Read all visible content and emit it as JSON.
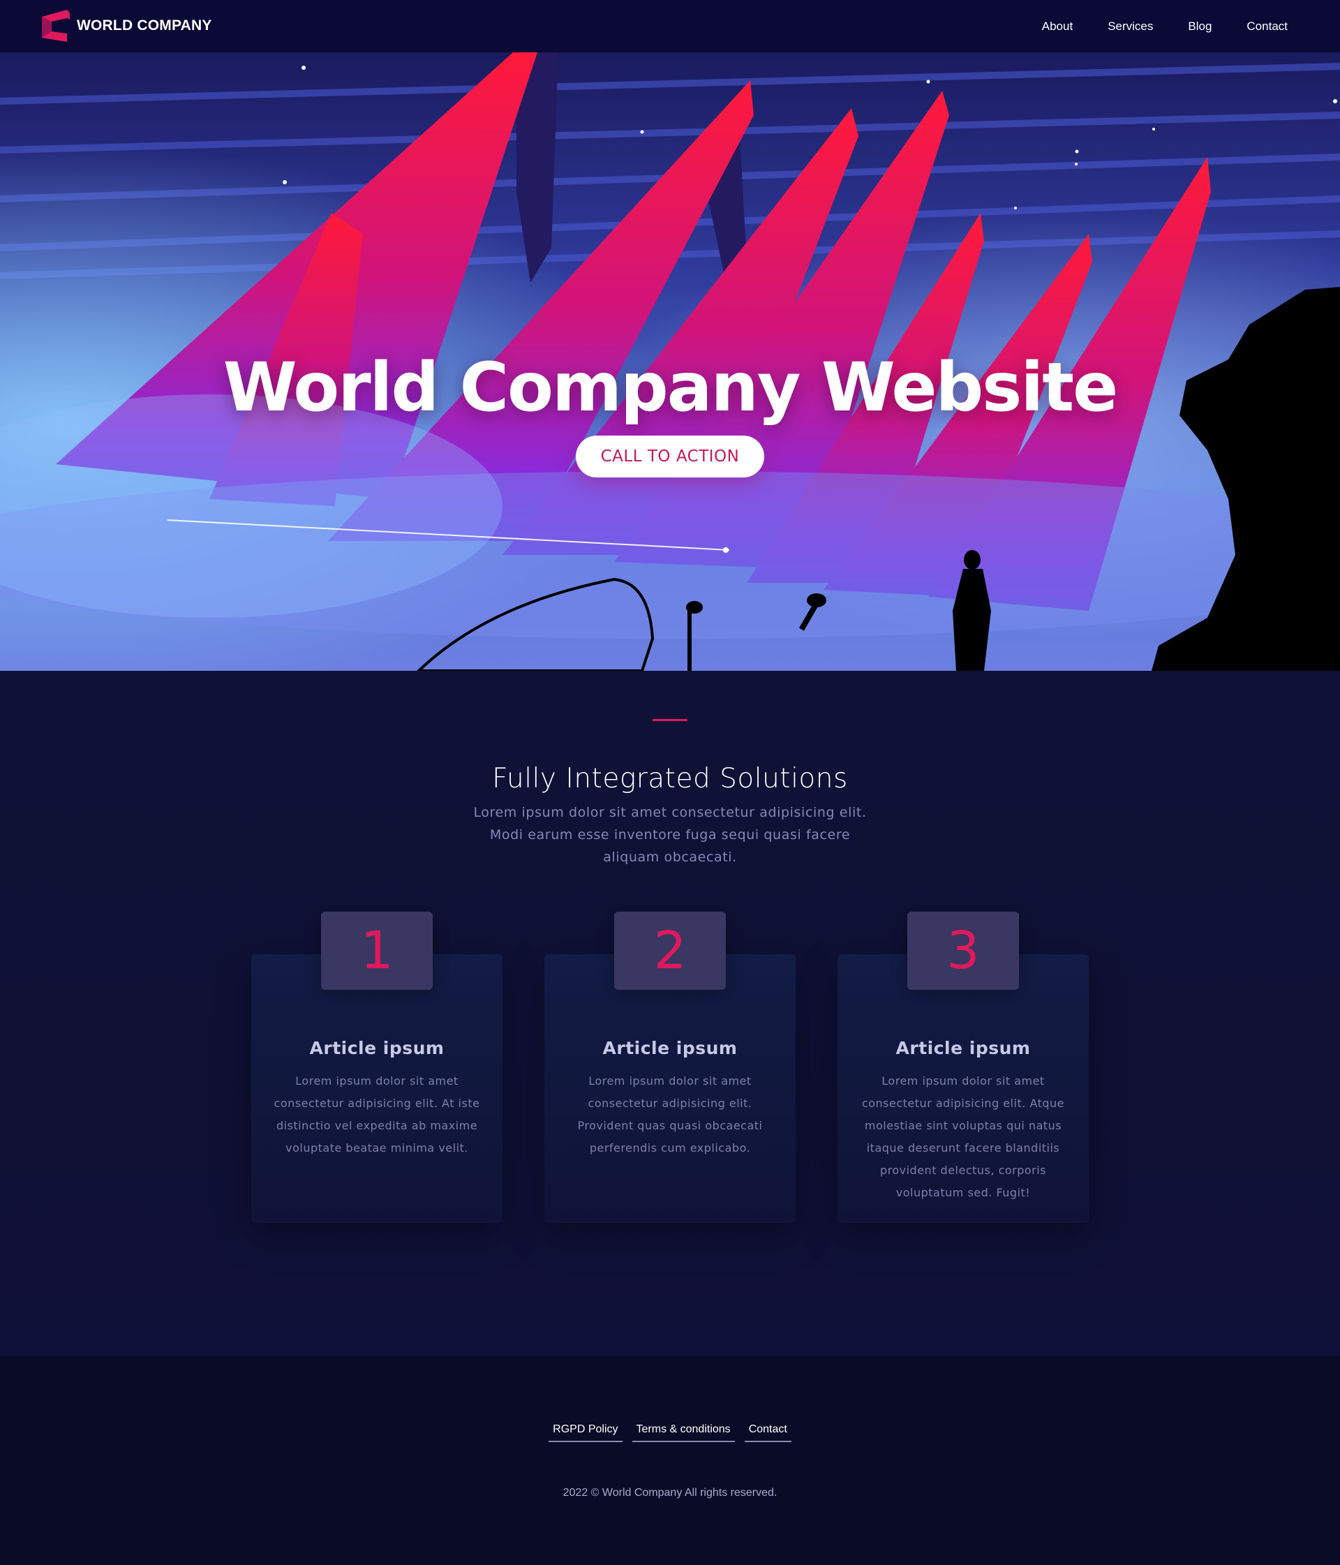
{
  "brand": {
    "name": "WORLD COMPANY",
    "color": "#e0195d"
  },
  "nav": {
    "items": [
      {
        "label": "About"
      },
      {
        "label": "Services"
      },
      {
        "label": "Blog"
      },
      {
        "label": "Contact"
      }
    ]
  },
  "hero": {
    "title": "World Company Website",
    "cta_label": "CALL TO ACTION"
  },
  "solutions": {
    "title": "Fully Integrated Solutions",
    "text": "Lorem ipsum dolor sit amet consectetur adipisicing elit. Modi earum esse inventore fuga sequi quasi facere aliquam obcaecati.",
    "cards": [
      {
        "number": "1",
        "title": "Article ipsum",
        "text": "Lorem ipsum dolor sit amet consectetur adipisicing elit. At iste distinctio vel expedita ab maxime voluptate beatae minima velit."
      },
      {
        "number": "2",
        "title": "Article ipsum",
        "text": "Lorem ipsum dolor sit amet consectetur adipisicing elit. Provident quas quasi obcaecati perferendis cum explicabo."
      },
      {
        "number": "3",
        "title": "Article ipsum",
        "text": "Lorem ipsum dolor sit amet consectetur adipisicing elit. Atque molestiae sint voluptas qui natus itaque deserunt facere blanditiis provident delectus, corporis voluptatum sed. Fugit!"
      }
    ]
  },
  "footer": {
    "links": [
      {
        "label": "RGPD Policy"
      },
      {
        "label": "Terms & conditions"
      },
      {
        "label": "Contact"
      }
    ],
    "copyright": "2022 © World Company All rights reserved."
  }
}
